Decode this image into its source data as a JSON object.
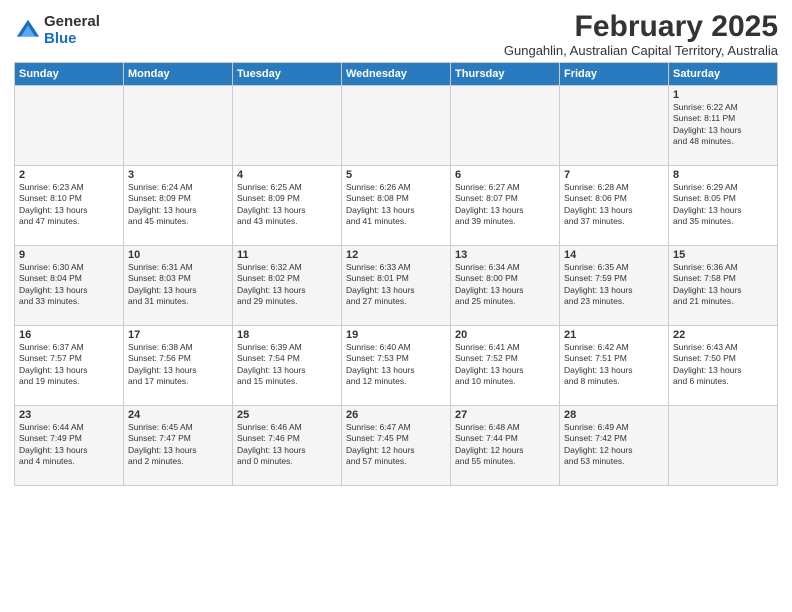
{
  "logo": {
    "general": "General",
    "blue": "Blue"
  },
  "title": "February 2025",
  "subtitle": "Gungahlin, Australian Capital Territory, Australia",
  "headers": [
    "Sunday",
    "Monday",
    "Tuesday",
    "Wednesday",
    "Thursday",
    "Friday",
    "Saturday"
  ],
  "weeks": [
    [
      {
        "day": "",
        "info": ""
      },
      {
        "day": "",
        "info": ""
      },
      {
        "day": "",
        "info": ""
      },
      {
        "day": "",
        "info": ""
      },
      {
        "day": "",
        "info": ""
      },
      {
        "day": "",
        "info": ""
      },
      {
        "day": "1",
        "info": "Sunrise: 6:22 AM\nSunset: 8:11 PM\nDaylight: 13 hours\nand 48 minutes."
      }
    ],
    [
      {
        "day": "2",
        "info": "Sunrise: 6:23 AM\nSunset: 8:10 PM\nDaylight: 13 hours\nand 47 minutes."
      },
      {
        "day": "3",
        "info": "Sunrise: 6:24 AM\nSunset: 8:09 PM\nDaylight: 13 hours\nand 45 minutes."
      },
      {
        "day": "4",
        "info": "Sunrise: 6:25 AM\nSunset: 8:09 PM\nDaylight: 13 hours\nand 43 minutes."
      },
      {
        "day": "5",
        "info": "Sunrise: 6:26 AM\nSunset: 8:08 PM\nDaylight: 13 hours\nand 41 minutes."
      },
      {
        "day": "6",
        "info": "Sunrise: 6:27 AM\nSunset: 8:07 PM\nDaylight: 13 hours\nand 39 minutes."
      },
      {
        "day": "7",
        "info": "Sunrise: 6:28 AM\nSunset: 8:06 PM\nDaylight: 13 hours\nand 37 minutes."
      },
      {
        "day": "8",
        "info": "Sunrise: 6:29 AM\nSunset: 8:05 PM\nDaylight: 13 hours\nand 35 minutes."
      }
    ],
    [
      {
        "day": "9",
        "info": "Sunrise: 6:30 AM\nSunset: 8:04 PM\nDaylight: 13 hours\nand 33 minutes."
      },
      {
        "day": "10",
        "info": "Sunrise: 6:31 AM\nSunset: 8:03 PM\nDaylight: 13 hours\nand 31 minutes."
      },
      {
        "day": "11",
        "info": "Sunrise: 6:32 AM\nSunset: 8:02 PM\nDaylight: 13 hours\nand 29 minutes."
      },
      {
        "day": "12",
        "info": "Sunrise: 6:33 AM\nSunset: 8:01 PM\nDaylight: 13 hours\nand 27 minutes."
      },
      {
        "day": "13",
        "info": "Sunrise: 6:34 AM\nSunset: 8:00 PM\nDaylight: 13 hours\nand 25 minutes."
      },
      {
        "day": "14",
        "info": "Sunrise: 6:35 AM\nSunset: 7:59 PM\nDaylight: 13 hours\nand 23 minutes."
      },
      {
        "day": "15",
        "info": "Sunrise: 6:36 AM\nSunset: 7:58 PM\nDaylight: 13 hours\nand 21 minutes."
      }
    ],
    [
      {
        "day": "16",
        "info": "Sunrise: 6:37 AM\nSunset: 7:57 PM\nDaylight: 13 hours\nand 19 minutes."
      },
      {
        "day": "17",
        "info": "Sunrise: 6:38 AM\nSunset: 7:56 PM\nDaylight: 13 hours\nand 17 minutes."
      },
      {
        "day": "18",
        "info": "Sunrise: 6:39 AM\nSunset: 7:54 PM\nDaylight: 13 hours\nand 15 minutes."
      },
      {
        "day": "19",
        "info": "Sunrise: 6:40 AM\nSunset: 7:53 PM\nDaylight: 13 hours\nand 12 minutes."
      },
      {
        "day": "20",
        "info": "Sunrise: 6:41 AM\nSunset: 7:52 PM\nDaylight: 13 hours\nand 10 minutes."
      },
      {
        "day": "21",
        "info": "Sunrise: 6:42 AM\nSunset: 7:51 PM\nDaylight: 13 hours\nand 8 minutes."
      },
      {
        "day": "22",
        "info": "Sunrise: 6:43 AM\nSunset: 7:50 PM\nDaylight: 13 hours\nand 6 minutes."
      }
    ],
    [
      {
        "day": "23",
        "info": "Sunrise: 6:44 AM\nSunset: 7:49 PM\nDaylight: 13 hours\nand 4 minutes."
      },
      {
        "day": "24",
        "info": "Sunrise: 6:45 AM\nSunset: 7:47 PM\nDaylight: 13 hours\nand 2 minutes."
      },
      {
        "day": "25",
        "info": "Sunrise: 6:46 AM\nSunset: 7:46 PM\nDaylight: 13 hours\nand 0 minutes."
      },
      {
        "day": "26",
        "info": "Sunrise: 6:47 AM\nSunset: 7:45 PM\nDaylight: 12 hours\nand 57 minutes."
      },
      {
        "day": "27",
        "info": "Sunrise: 6:48 AM\nSunset: 7:44 PM\nDaylight: 12 hours\nand 55 minutes."
      },
      {
        "day": "28",
        "info": "Sunrise: 6:49 AM\nSunset: 7:42 PM\nDaylight: 12 hours\nand 53 minutes."
      },
      {
        "day": "",
        "info": ""
      }
    ]
  ]
}
